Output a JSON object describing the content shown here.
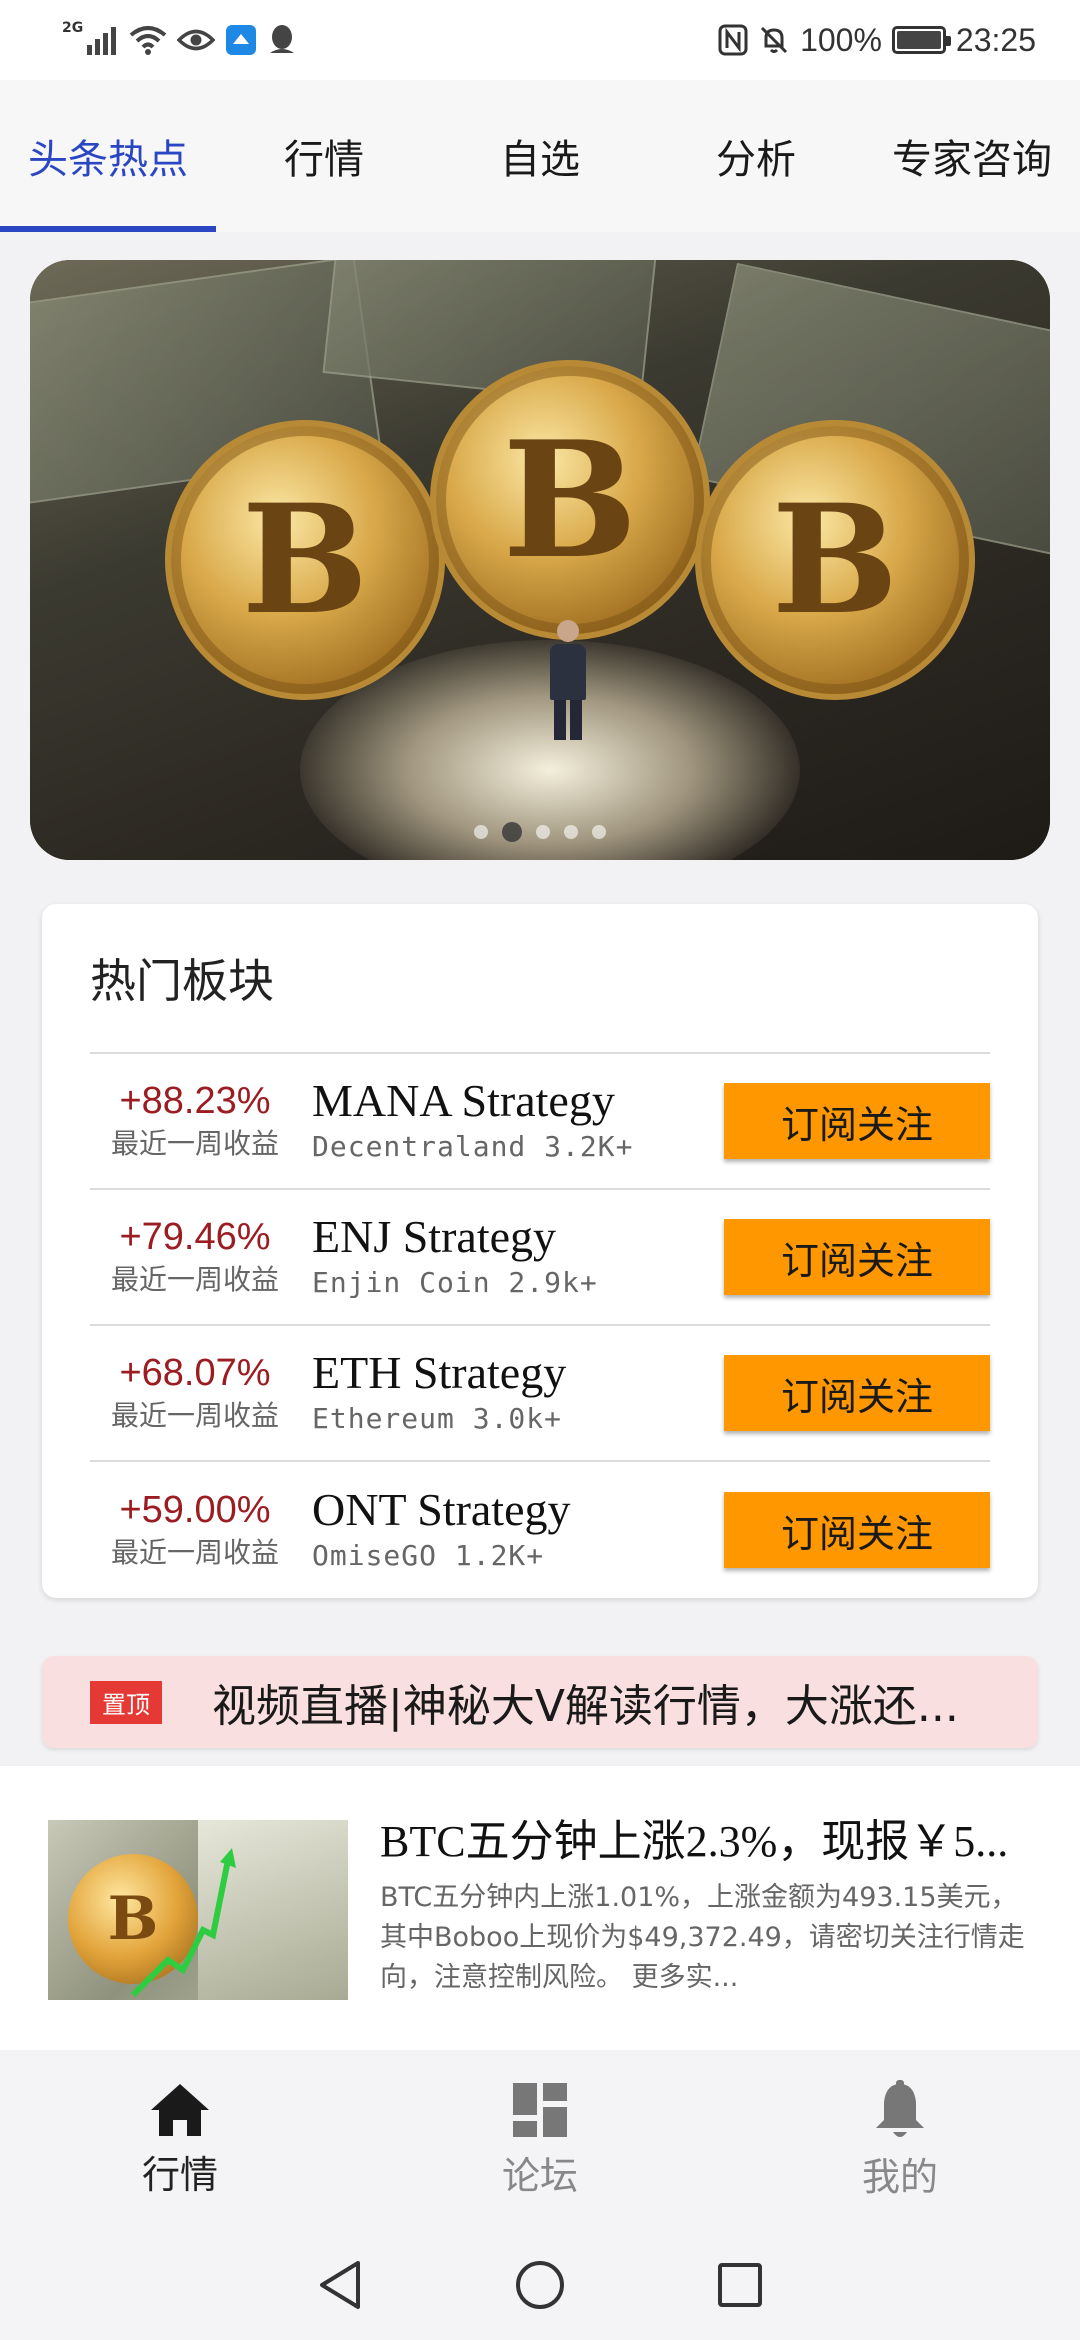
{
  "status_bar": {
    "network": "2G",
    "battery": "100%",
    "time": "23:25",
    "icons": [
      "signal-icon",
      "wifi-icon",
      "eye-icon",
      "app-notify-icon",
      "qq-icon",
      "nfc-icon",
      "mute-icon",
      "battery-icon"
    ]
  },
  "top_tabs": [
    {
      "label": "头条热点",
      "active": true
    },
    {
      "label": "行情",
      "active": false
    },
    {
      "label": "自选",
      "active": false
    },
    {
      "label": "分析",
      "active": false
    },
    {
      "label": "专家咨询",
      "active": false
    }
  ],
  "banner": {
    "coin_symbol": "B",
    "dot_count": 5,
    "active_dot": 2
  },
  "hot_sectors": {
    "title": "热门板块",
    "rows": [
      {
        "pct": "+88.23%",
        "pct_label": "最近一周收益",
        "name": "MANA Strategy",
        "sub": "Decentraland 3.2K+",
        "button": "订阅关注"
      },
      {
        "pct": "+79.46%",
        "pct_label": "最近一周收益",
        "name": "ENJ Strategy",
        "sub": "Enjin Coin 2.9k+",
        "button": "订阅关注"
      },
      {
        "pct": "+68.07%",
        "pct_label": "最近一周收益",
        "name": "ETH Strategy",
        "sub": "Ethereum 3.0k+",
        "button": "订阅关注"
      },
      {
        "pct": "+59.00%",
        "pct_label": "最近一周收益",
        "name": "ONT Strategy",
        "sub": "OmiseGO 1.2K+",
        "button": "订阅关注"
      }
    ]
  },
  "pinned": {
    "tag": "置顶",
    "text": "视频直播|神秘大V解读行情，大涨还..."
  },
  "news": {
    "title": "BTC五分钟上涨2.3%，现报￥5...",
    "desc": "BTC五分钟内上涨1.01%，上涨金额为493.15美元，其中Boboo上现价为$49,372.49，请密切关注行情走向，注意控制风险。 更多实..."
  },
  "bottom_nav": [
    {
      "label": "行情",
      "icon": "home-icon",
      "active": true
    },
    {
      "label": "论坛",
      "icon": "dashboard-icon",
      "active": false
    },
    {
      "label": "我的",
      "icon": "bell-icon",
      "active": false
    }
  ],
  "colors": {
    "accent": "#2b46c2",
    "gain": "#9b1d22",
    "button": "#ff9800",
    "pin_tag": "#e53935",
    "pin_bg": "#fadfe0"
  }
}
